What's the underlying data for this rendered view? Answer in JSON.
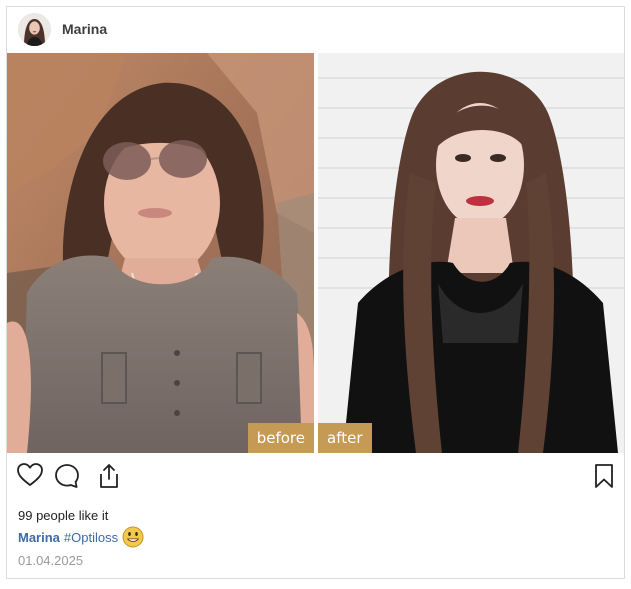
{
  "post": {
    "username": "Marina",
    "before_label": "before",
    "after_label": "after",
    "likes_text": "99 people like it",
    "caption_author": "Marina",
    "caption_hashtag": "#Optiloss",
    "date": "01.04.2025"
  },
  "icons": {
    "like": "heart-icon",
    "comment": "comment-icon",
    "share": "share-icon",
    "save": "bookmark-icon",
    "emoji": "smiley-emoji-icon"
  },
  "colors": {
    "tag_bg": "#c59a54",
    "link": "#3f6aa3",
    "date": "#9a9a9a",
    "border": "#dcdcdc"
  }
}
